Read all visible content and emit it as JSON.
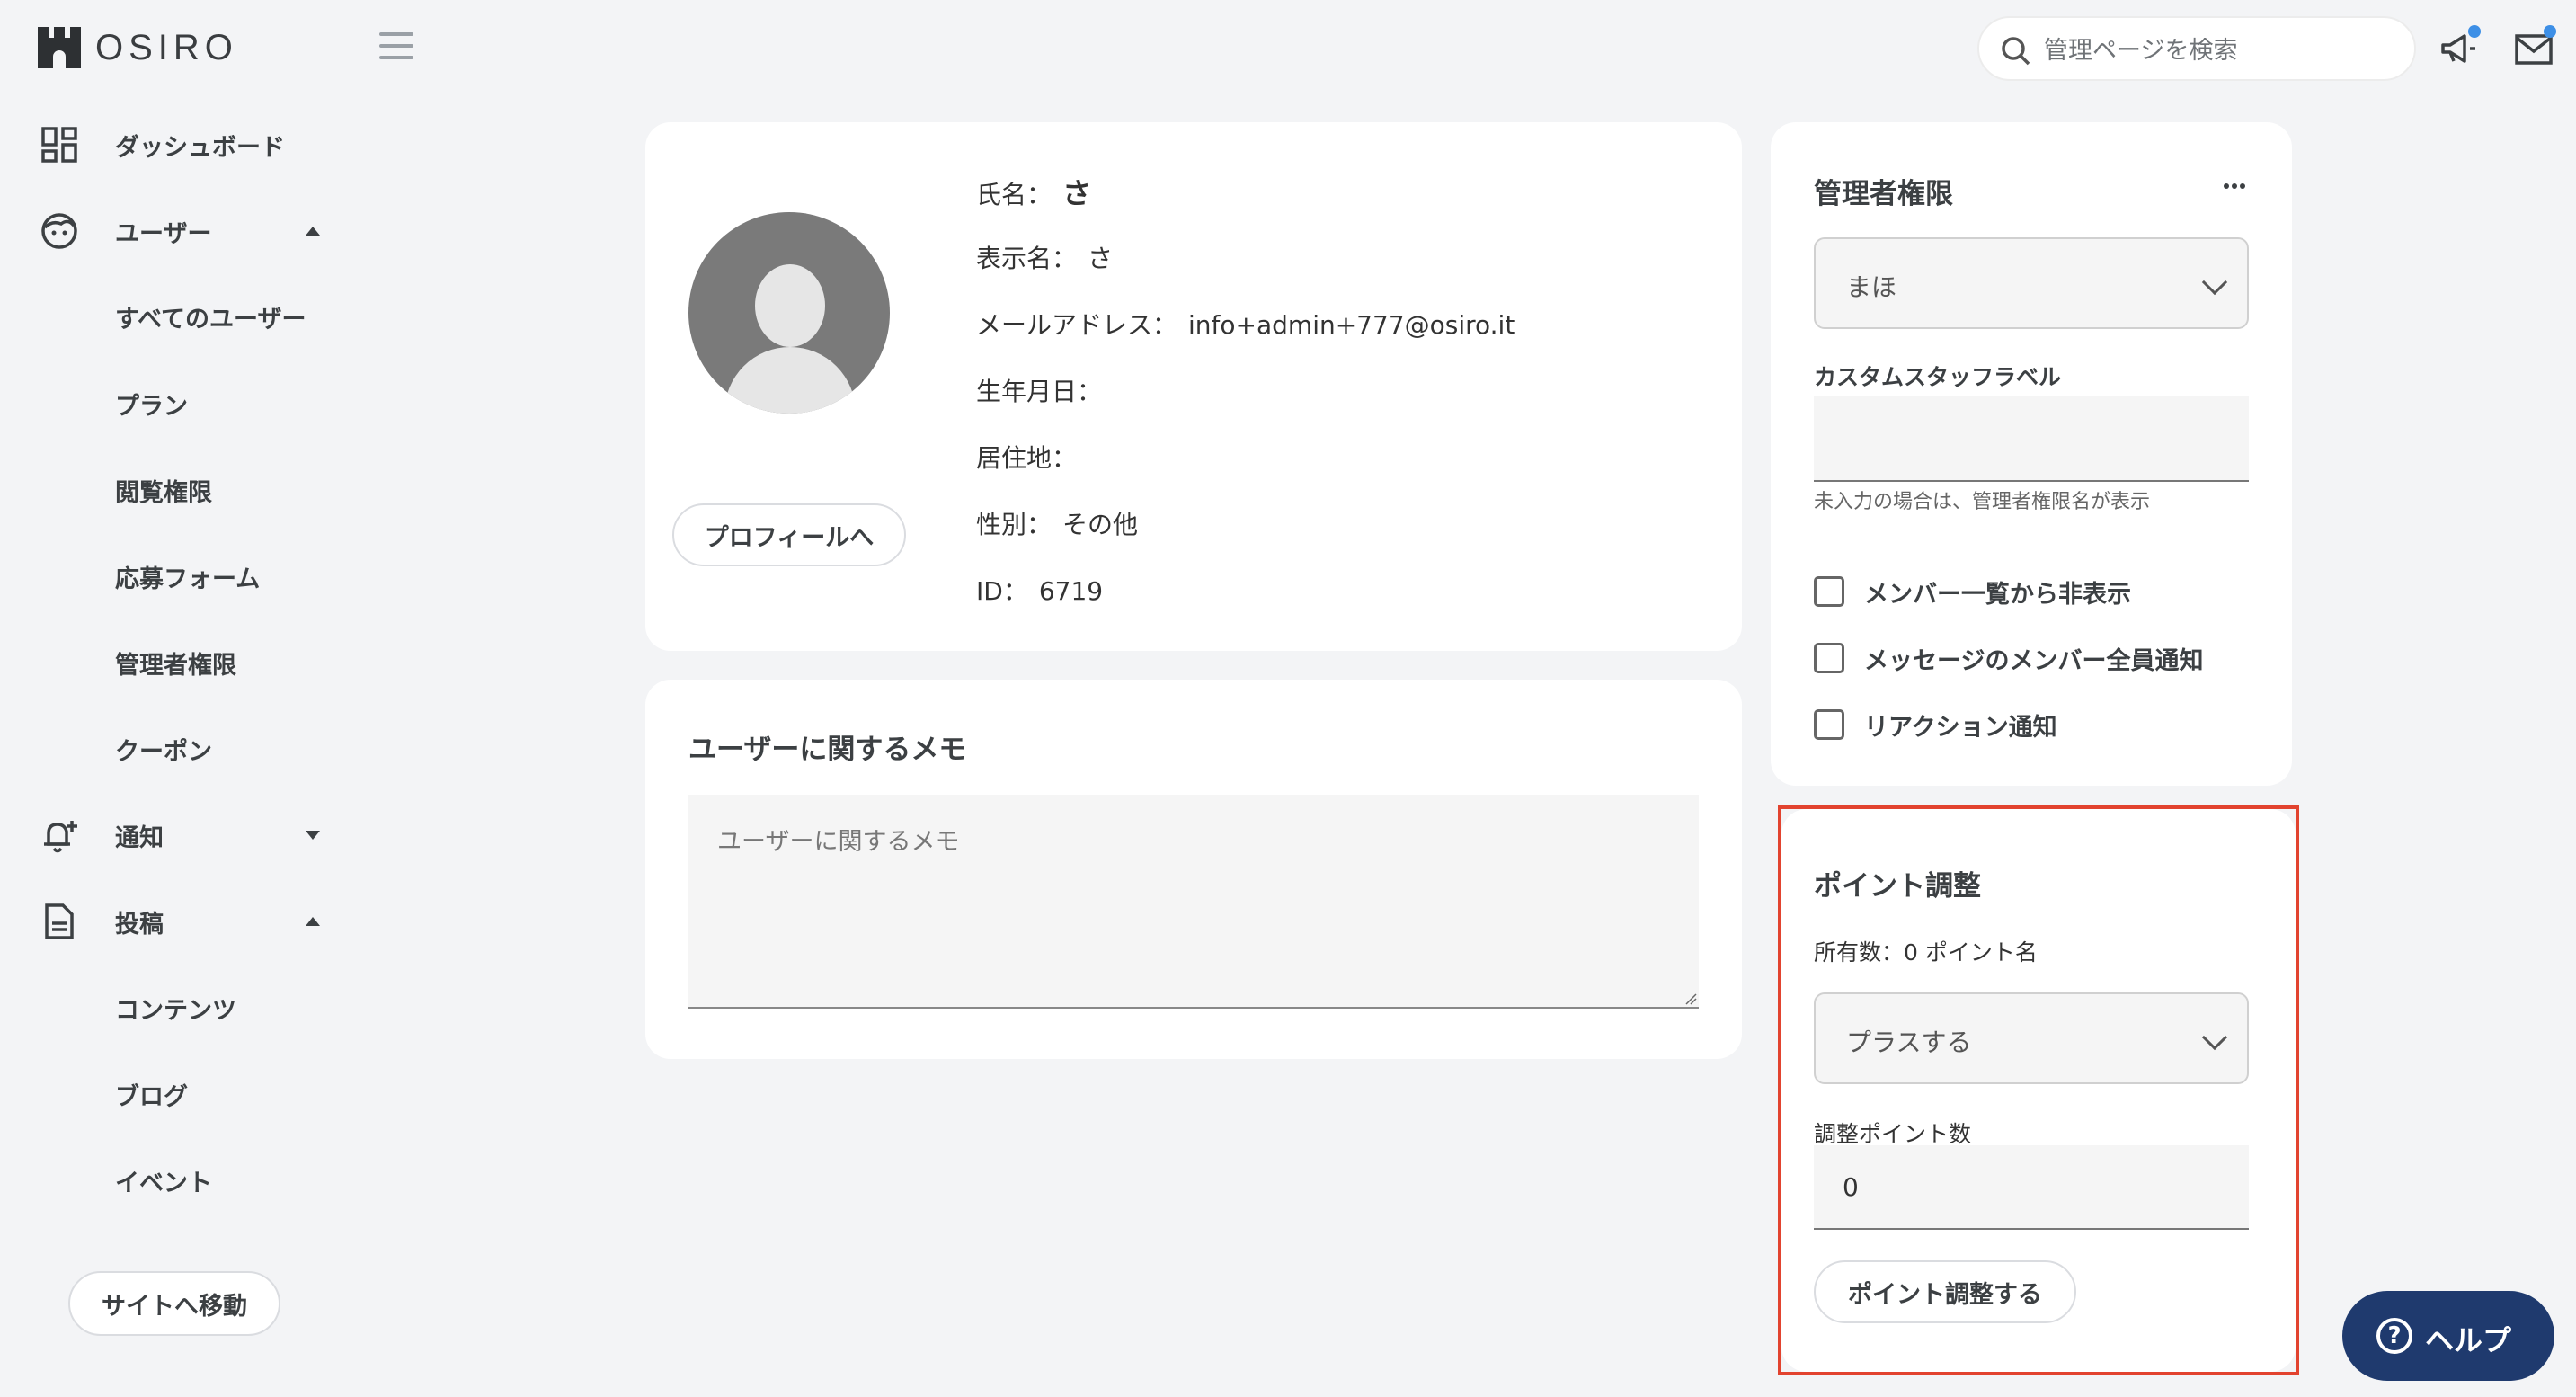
{
  "app": {
    "logo_text": "OSIRO"
  },
  "header": {
    "search_placeholder": "管理ページを検索",
    "colors": {
      "notification_dot": "#3d8fe6"
    }
  },
  "sidebar": {
    "items": [
      {
        "label": "ダッシュボード",
        "icon": "dashboard-icon"
      },
      {
        "label": "ユーザー",
        "icon": "user-face-icon",
        "expanded": true
      },
      {
        "label": "通知",
        "icon": "bell-plus-icon",
        "expanded": false
      },
      {
        "label": "投稿",
        "icon": "document-icon",
        "expanded": true
      }
    ],
    "user_sub": [
      "すべてのユーザー",
      "プラン",
      "閲覧権限",
      "応募フォーム",
      "管理者権限",
      "クーポン"
    ],
    "post_sub": [
      "コンテンツ",
      "ブログ",
      "イベント"
    ],
    "site_button": "サイトへ移動"
  },
  "profile": {
    "button": "プロフィールへ",
    "rows": [
      {
        "label": "氏名：",
        "value": "さ"
      },
      {
        "label": "表示名：",
        "value": "さ"
      },
      {
        "label": "メールアドレス：",
        "value": "info+admin+777@osiro.it"
      },
      {
        "label": "生年月日：",
        "value": ""
      },
      {
        "label": "居住地：",
        "value": ""
      },
      {
        "label": "性別：",
        "value": "その他"
      },
      {
        "label": "ID：",
        "value": "6719"
      }
    ]
  },
  "memo": {
    "title": "ユーザーに関するメモ",
    "placeholder": "ユーザーに関するメモ"
  },
  "admin": {
    "title": "管理者権限",
    "role_select": "まほ",
    "custom_label_title": "カスタムスタッフラベル",
    "custom_label_value": "",
    "helper": "未入力の場合は、管理者権限名が表示",
    "checkboxes": [
      {
        "label": "メンバー一覧から非表示",
        "checked": false
      },
      {
        "label": "メッセージのメンバー全員通知",
        "checked": false
      },
      {
        "label": "リアクション通知",
        "checked": false
      }
    ]
  },
  "points": {
    "title": "ポイント調整",
    "owned": "所有数：0 ポイント名",
    "mode_select": "プラスする",
    "amount_label": "調整ポイント数",
    "amount_value": "0",
    "submit": "ポイント調整する",
    "highlight_color": "#e2432f"
  },
  "help": {
    "label": "ヘルプ",
    "glyph": "?",
    "color": "#1f3a6e"
  }
}
